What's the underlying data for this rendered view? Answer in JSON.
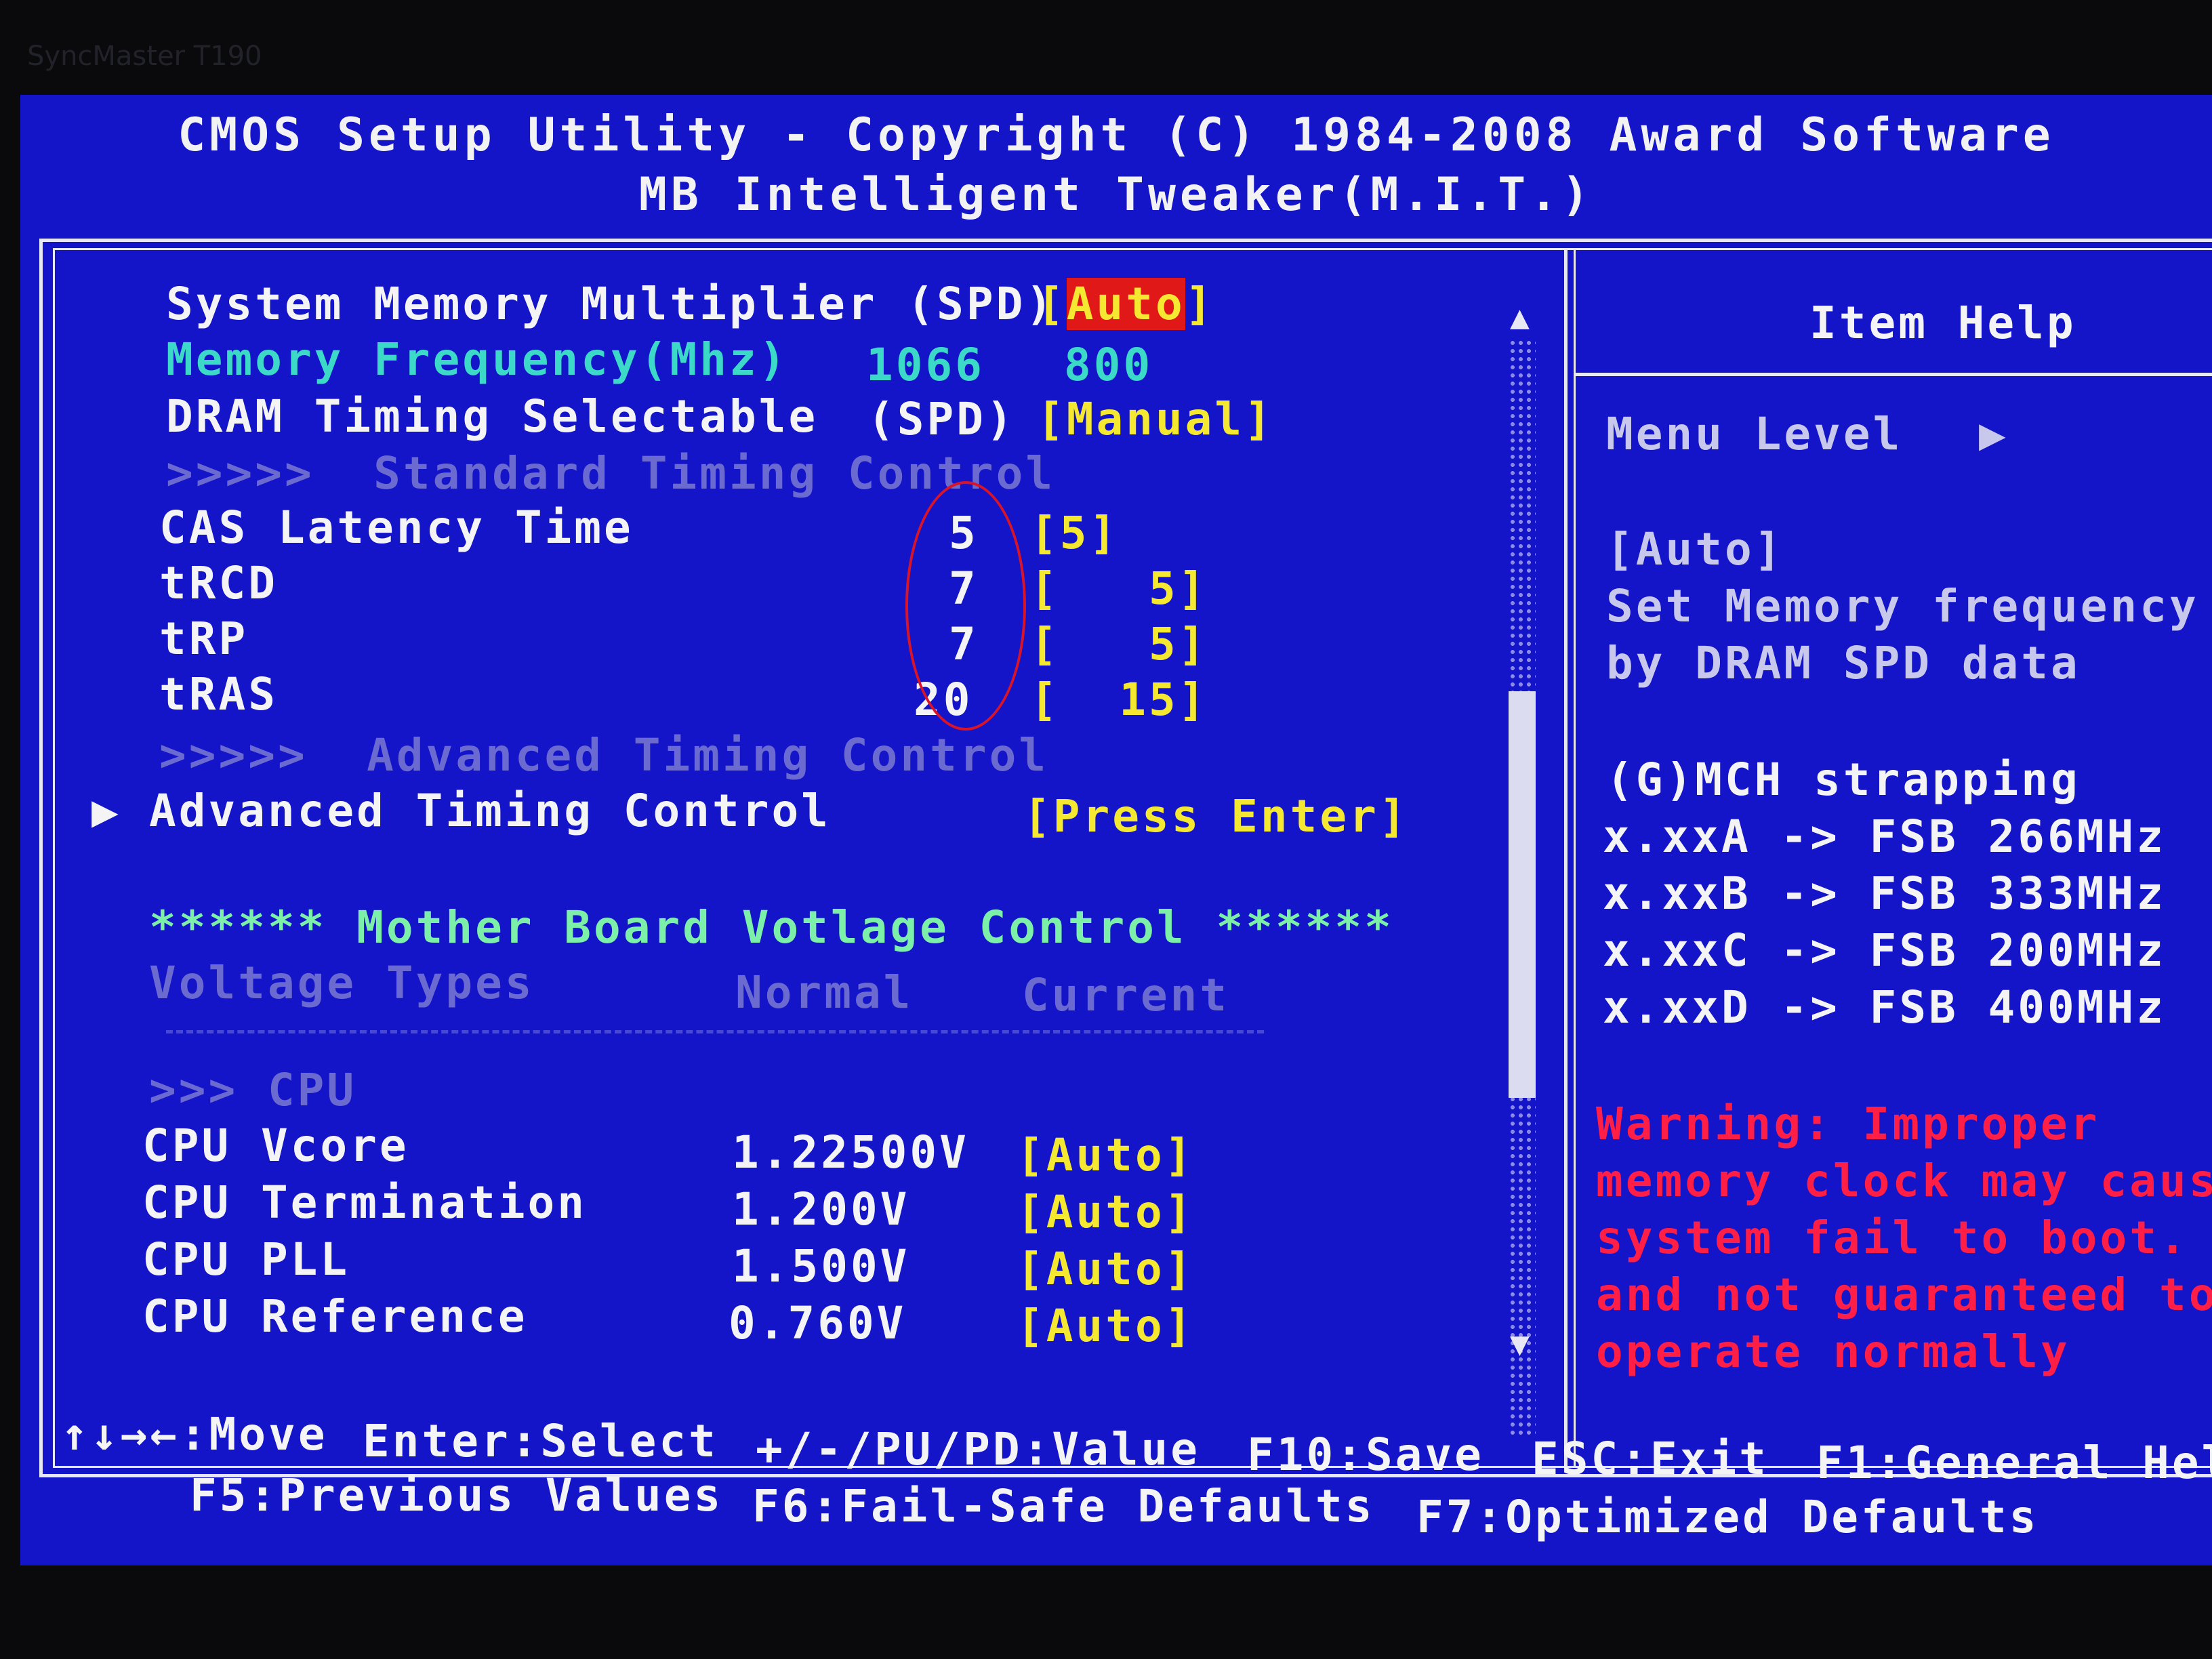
{
  "monitor_label": "SyncMaster T190",
  "header": {
    "line1": "CMOS Setup Utility - Copyright (C) 1984-2008 Award Software",
    "line2": "MB Intelligent Tweaker(M.I.T.)"
  },
  "settings": {
    "mem_mult": {
      "label": "System Memory Multiplier (SPD)",
      "value_open": "[",
      "value": "Auto",
      "value_close": "]"
    },
    "mem_freq": {
      "label": "Memory Frequency(Mhz)",
      "current": "1066",
      "setting": "800"
    },
    "dram_sel": {
      "label": "DRAM Timing Selectable",
      "mode": "(SPD)",
      "value": "[Manual]"
    },
    "std_header": ">>>>>  Standard Timing Control",
    "cas": {
      "label": "CAS Latency Time",
      "current": "5",
      "value": "[5]"
    },
    "trcd": {
      "label": "tRCD",
      "current": "7",
      "value": "[   5]"
    },
    "trp": {
      "label": "tRP",
      "current": "7",
      "value": "[   5]"
    },
    "tras": {
      "label": "tRAS",
      "current": "20",
      "value": "[  15]"
    },
    "adv_header": ">>>>>  Advanced Timing Control",
    "adv_menu": {
      "label": "Advanced Timing Control",
      "value": "[Press Enter]"
    },
    "mb_voltage_header": "****** Mother Board Votlage Control ******",
    "volt_cols": {
      "type": "Voltage Types",
      "normal": "Normal",
      "current": "Current"
    },
    "cpu_header": ">>> CPU",
    "cpu_vcore": {
      "label": "CPU Vcore",
      "normal": "1.22500V",
      "value": "[Auto]"
    },
    "cpu_term": {
      "label": "CPU Termination",
      "normal": "1.200V",
      "value": "[Auto]"
    },
    "cpu_pll": {
      "label": "CPU PLL",
      "normal": "1.500V",
      "value": "[Auto]"
    },
    "cpu_ref": {
      "label": "CPU Reference",
      "normal": "0.760V",
      "value": "[Auto]"
    }
  },
  "help": {
    "title": "Item Help",
    "menu_level": "Menu Level",
    "lines": [
      "[Auto]",
      "Set Memory frequency",
      "by DRAM SPD data"
    ],
    "strap_title": "(G)MCH strapping",
    "straps": [
      "x.xxA -> FSB 266MHz",
      "x.xxB -> FSB 333MHz",
      "x.xxC -> FSB 200MHz",
      "x.xxD -> FSB 400MHz"
    ],
    "warning": [
      "Warning: Improper",
      "memory clock may cause",
      "system fail to boot.",
      "and not guaranteed to",
      "operate normally"
    ]
  },
  "footer": {
    "move": "↑↓→←:Move",
    "select": "Enter:Select",
    "value": "+/-/PU/PD:Value",
    "save": "F10:Save",
    "exit": "ESC:Exit",
    "general": "F1:General Hel",
    "prev": "F5:Previous Values",
    "failsafe": "F6:Fail-Safe Defaults",
    "optimized": "F7:Optimized Defaults"
  },
  "icons": {
    "menu_pointer": "triangle-right-icon",
    "scroll_up": "triangle-up-icon",
    "scroll_down": "triangle-down-icon"
  }
}
